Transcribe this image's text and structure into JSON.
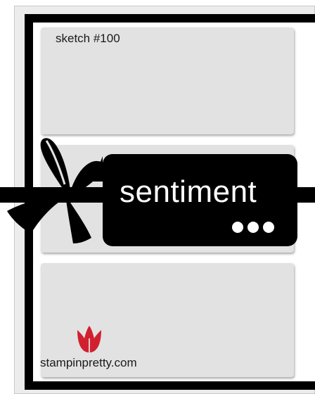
{
  "sketch": {
    "label": "sketch #100"
  },
  "tag": {
    "sentiment": "sentiment"
  },
  "footer": {
    "site": "stampinpretty.com"
  },
  "colors": {
    "frame": "#000000",
    "panel": "#e2e2e2",
    "logo": "#d0202f"
  },
  "icons": {
    "logo": "tulip-icon",
    "bow": "ribbon-bow-icon"
  }
}
